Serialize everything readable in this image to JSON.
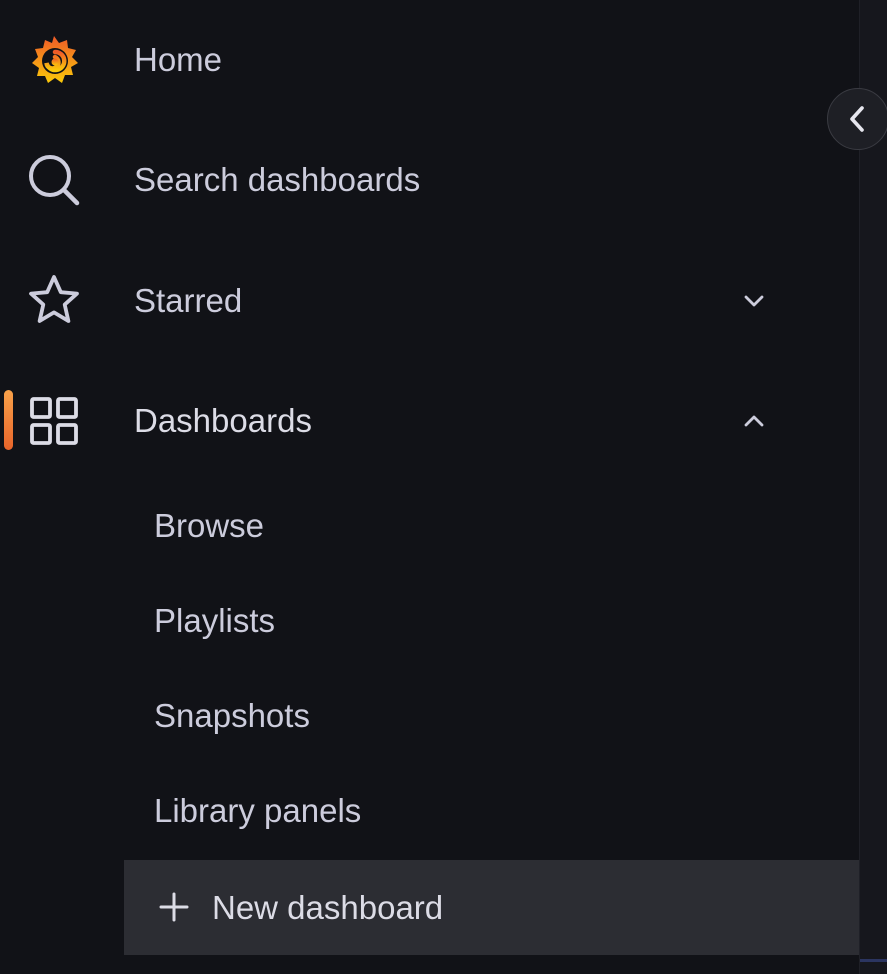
{
  "nav": {
    "home": {
      "label": "Home",
      "icon": "grafana-logo-icon"
    },
    "search": {
      "label": "Search dashboards",
      "icon": "search-icon"
    },
    "starred": {
      "label": "Starred",
      "icon": "star-icon",
      "expanded": false
    },
    "dashboards": {
      "label": "Dashboards",
      "icon": "apps-grid-icon",
      "expanded": true,
      "active": true
    }
  },
  "dashboards_menu": {
    "items": [
      {
        "label": "Browse"
      },
      {
        "label": "Playlists"
      },
      {
        "label": "Snapshots"
      },
      {
        "label": "Library panels"
      }
    ],
    "new_dashboard": {
      "label": "New dashboard",
      "icon": "plus-icon"
    }
  },
  "controls": {
    "collapse_icon": "chevron-left-icon"
  },
  "colors": {
    "background": "#111217",
    "text": "#ccccdc",
    "active_accent": "#f17a34",
    "highlight_bg": "#2c2d33"
  }
}
